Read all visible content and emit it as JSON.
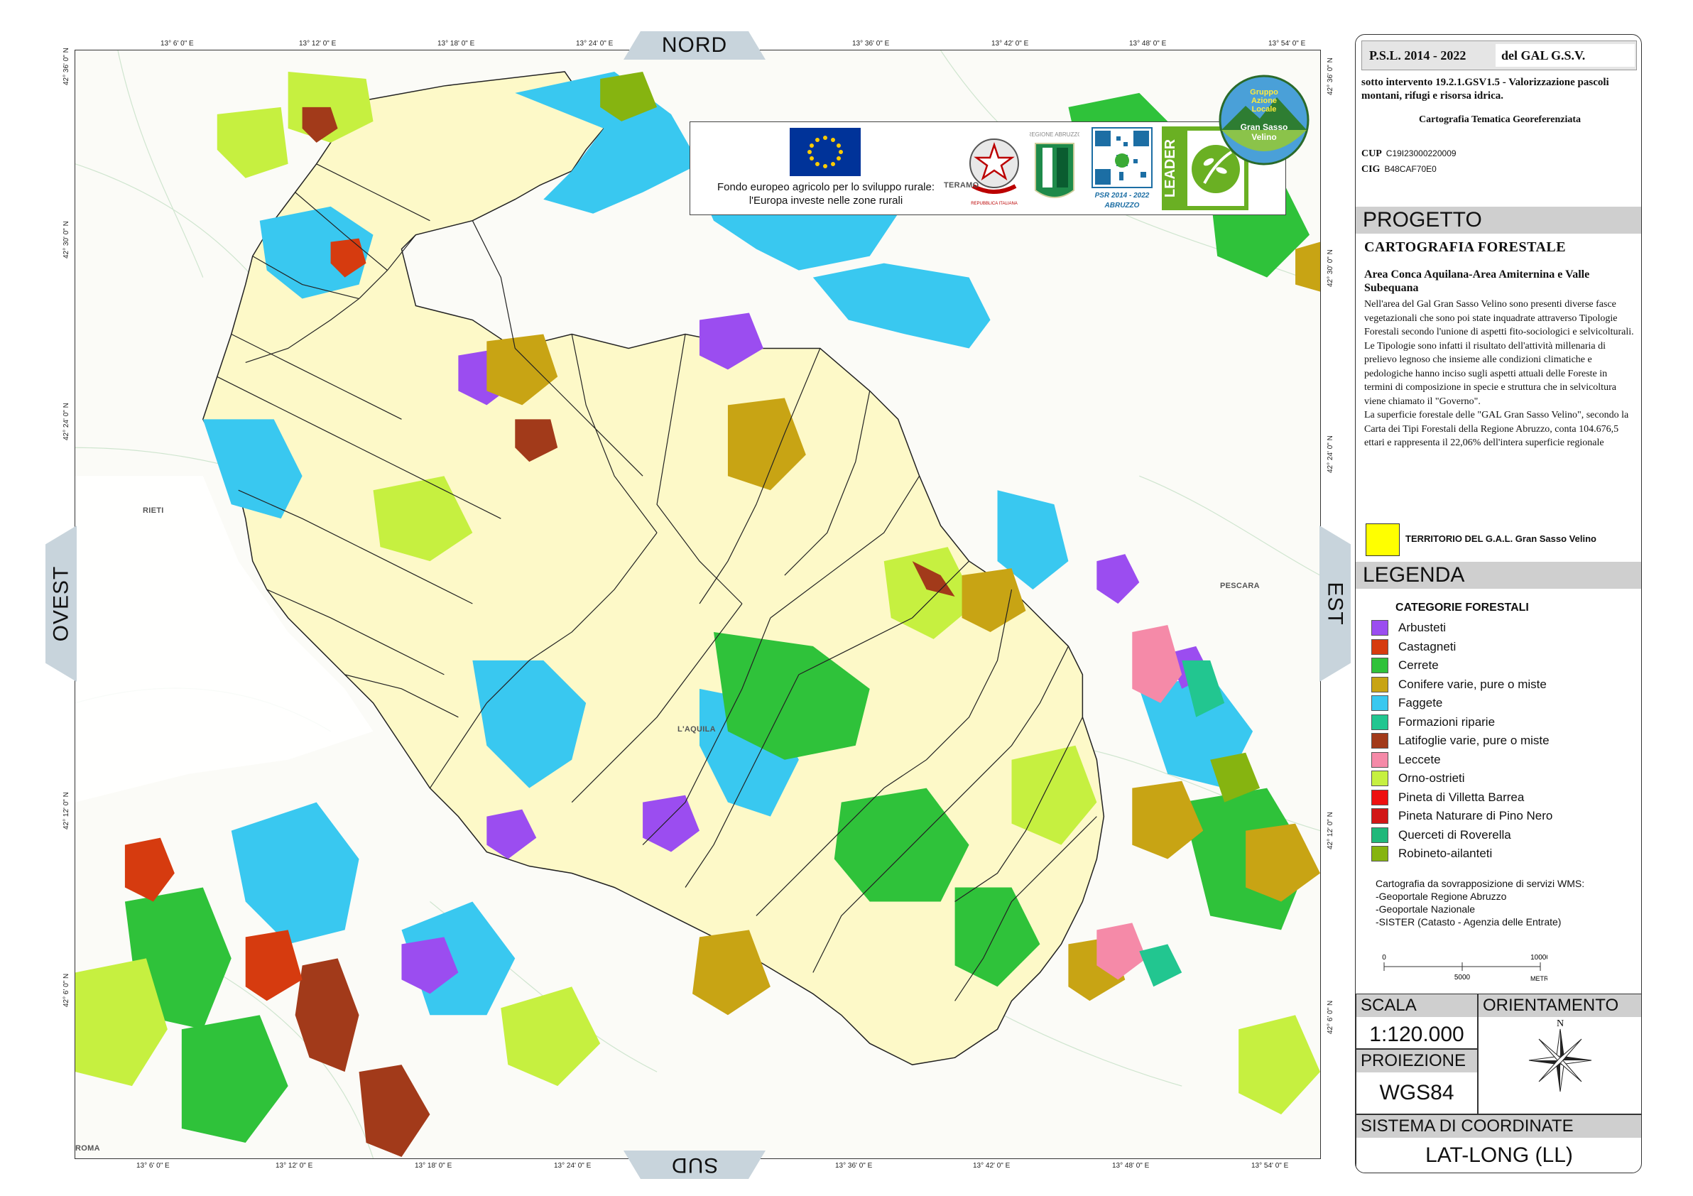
{
  "map": {
    "directions": {
      "north": "NORD",
      "south": "SUD",
      "west": "OVEST",
      "east": "EST"
    },
    "top_coords": [
      "13° 6' 0\" E",
      "13° 12' 0\" E",
      "13° 18' 0\" E",
      "13° 24' 0\" E",
      "13° 36' 0\" E",
      "13° 42' 0\" E",
      "13° 48' 0\" E",
      "13° 54' 0\" E"
    ],
    "bottom_coords": [
      "13° 6' 0\" E",
      "13° 12' 0\" E",
      "13° 18' 0\" E",
      "13° 24' 0\" E",
      "13° 36' 0\" E",
      "13° 42' 0\" E",
      "13° 48' 0\" E",
      "13° 54' 0\" E"
    ],
    "left_coords": [
      "42° 36' 0\" N",
      "42° 30' 0\" N",
      "42° 24' 0\" N",
      "42° 12' 0\" N",
      "42° 6' 0\" N"
    ],
    "right_coords": [
      "42° 36' 0\" N",
      "42° 30' 0\" N",
      "42° 24' 0\" N",
      "42° 12' 0\" N",
      "42° 6' 0\" N"
    ],
    "places": {
      "teramo": "TERAMO",
      "rieti": "RIETI",
      "pescara": "PESCARA",
      "laquila": "L'AQUILA",
      "roma": "ROMA"
    },
    "banner": {
      "eu_caption_line1": "Fondo europeo agricolo per lo sviluppo rurale:",
      "eu_caption_line2": "l'Europa investe nelle zone rurali",
      "regione_text": "REGIONE ABRUZZO",
      "republic_text": "REPUBBLICA ITALIANA",
      "psr_line1": "PSR 2014 - 2022",
      "psr_line2": "ABRUZZO",
      "leader_text": "LEADER",
      "gal_logo_line1": "Gruppo",
      "gal_logo_line2": "Azione",
      "gal_logo_line3": "Locale",
      "gal_logo_line4": "Gran Sasso",
      "gal_logo_line5": "Velino"
    }
  },
  "panel": {
    "psl": "P.S.L. 2014 - 2022",
    "gal": "del GAL G.S.V.",
    "subintervento": "sotto intervento 19.2.1.GSV1.5  -  Valorizzazione pascoli montani, rifugi e risorsa idrica.",
    "cartografia_tematica": "Cartografia Tematica Georeferenziata",
    "cup_key": "CUP",
    "cup_val": "C19I23000220009",
    "cig_key": "CIG",
    "cig_val": "B48CAF70E0",
    "progetto_bar": "PROGETTO",
    "project_title": "CARTOGRAFIA FORESTALE",
    "project_sub": "Area Conca Aquilana-Area Amiternina e Valle Subequana",
    "project_body": "Nell'area del Gal Gran Sasso Velino sono presenti diverse fasce vegetazionali che sono poi state inquadrate attraverso Tipologie Forestali secondo l'unione di aspetti fito-sociologici e selvicolturali.\nLe Tipologie sono infatti il risultato dell'attività millenaria di prelievo legnoso che insieme alle condizioni climatiche e pedologiche hanno inciso sugli aspetti attuali delle Foreste in termini di composizione in specie e struttura che in selvicoltura viene chiamato il \"Governo\".\nLa superficie forestale delle \"GAL Gran Sasso Velino\", secondo la Carta dei Tipi Forestali della Regione Abruzzo, conta 104.676,5 ettari e rappresenta il 22,06% dell'intera superficie regionale",
    "territorio_label": "TERRITORIO DEL G.A.L. Gran Sasso Velino",
    "legenda_bar": "LEGENDA",
    "legend_header": "CATEGORIE FORESTALI",
    "legend": [
      {
        "label": "Arbusteti",
        "color": "#9b4df0"
      },
      {
        "label": "Castagneti",
        "color": "#d63b0f"
      },
      {
        "label": "Cerrete",
        "color": "#2fc23a"
      },
      {
        "label": "Conifere varie, pure o miste",
        "color": "#c8a414"
      },
      {
        "label": "Faggete",
        "color": "#39c8f0"
      },
      {
        "label": "Formazioni riparie",
        "color": "#22c690"
      },
      {
        "label": "Latifoglie varie, pure o miste",
        "color": "#a23a1a"
      },
      {
        "label": "Leccete",
        "color": "#f58aa8"
      },
      {
        "label": "Orno-ostrieti",
        "color": "#c6f040"
      },
      {
        "label": "Pineta di Villetta Barrea",
        "color": "#ee1010"
      },
      {
        "label": "Pineta Naturare di Pino Nero",
        "color": "#d21616"
      },
      {
        "label": "Querceti di Roverella",
        "color": "#20b87a"
      },
      {
        "label": "Robineto-ailanteti",
        "color": "#86b410"
      }
    ],
    "wms_note": "Cartografia da sovrapposizione di servizi WMS:\n-Geoportale Regione Abruzzo\n-Geoportale Nazionale\n-SISTER (Catasto - Agenzia delle Entrate)",
    "scalebar": {
      "t0": "0",
      "t1": "5000",
      "t2": "10000",
      "unit": "METRI"
    },
    "scala_title": "SCALA",
    "scala_value": "1:120.000",
    "orient_title": "ORIENTAMENTO",
    "orient_n": "N",
    "proiezione_title": "PROIEZIONE",
    "proiezione_value": "WGS84",
    "sistema_title": "SISTEMA DI COORDINATE",
    "sistema_value": "LAT-LONG (LL)"
  },
  "colors": {
    "gal_territory": "#fdf9c8",
    "boundary": "#333333"
  }
}
